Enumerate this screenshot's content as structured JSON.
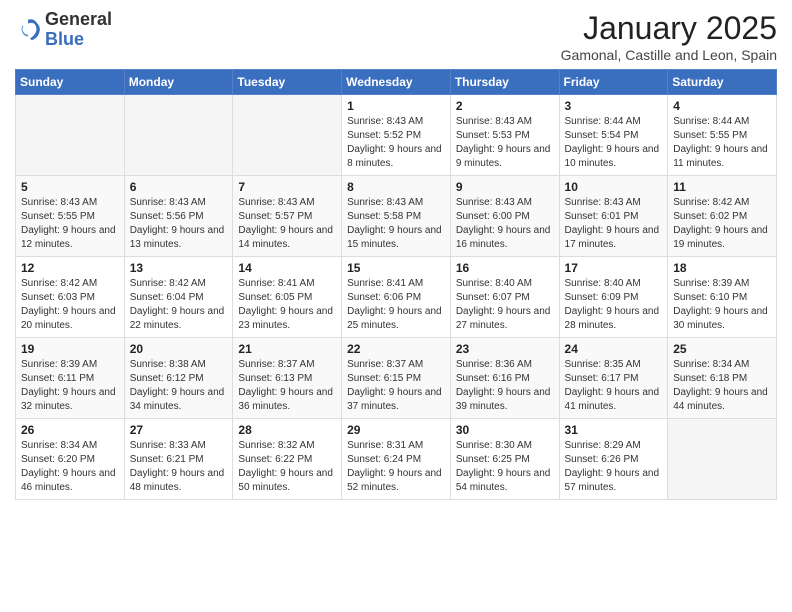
{
  "header": {
    "logo_general": "General",
    "logo_blue": "Blue",
    "month_title": "January 2025",
    "location": "Gamonal, Castille and Leon, Spain"
  },
  "weekdays": [
    "Sunday",
    "Monday",
    "Tuesday",
    "Wednesday",
    "Thursday",
    "Friday",
    "Saturday"
  ],
  "weeks": [
    [
      {
        "day": "",
        "info": ""
      },
      {
        "day": "",
        "info": ""
      },
      {
        "day": "",
        "info": ""
      },
      {
        "day": "1",
        "info": "Sunrise: 8:43 AM\nSunset: 5:52 PM\nDaylight: 9 hours and 8 minutes."
      },
      {
        "day": "2",
        "info": "Sunrise: 8:43 AM\nSunset: 5:53 PM\nDaylight: 9 hours and 9 minutes."
      },
      {
        "day": "3",
        "info": "Sunrise: 8:44 AM\nSunset: 5:54 PM\nDaylight: 9 hours and 10 minutes."
      },
      {
        "day": "4",
        "info": "Sunrise: 8:44 AM\nSunset: 5:55 PM\nDaylight: 9 hours and 11 minutes."
      }
    ],
    [
      {
        "day": "5",
        "info": "Sunrise: 8:43 AM\nSunset: 5:55 PM\nDaylight: 9 hours and 12 minutes."
      },
      {
        "day": "6",
        "info": "Sunrise: 8:43 AM\nSunset: 5:56 PM\nDaylight: 9 hours and 13 minutes."
      },
      {
        "day": "7",
        "info": "Sunrise: 8:43 AM\nSunset: 5:57 PM\nDaylight: 9 hours and 14 minutes."
      },
      {
        "day": "8",
        "info": "Sunrise: 8:43 AM\nSunset: 5:58 PM\nDaylight: 9 hours and 15 minutes."
      },
      {
        "day": "9",
        "info": "Sunrise: 8:43 AM\nSunset: 6:00 PM\nDaylight: 9 hours and 16 minutes."
      },
      {
        "day": "10",
        "info": "Sunrise: 8:43 AM\nSunset: 6:01 PM\nDaylight: 9 hours and 17 minutes."
      },
      {
        "day": "11",
        "info": "Sunrise: 8:42 AM\nSunset: 6:02 PM\nDaylight: 9 hours and 19 minutes."
      }
    ],
    [
      {
        "day": "12",
        "info": "Sunrise: 8:42 AM\nSunset: 6:03 PM\nDaylight: 9 hours and 20 minutes."
      },
      {
        "day": "13",
        "info": "Sunrise: 8:42 AM\nSunset: 6:04 PM\nDaylight: 9 hours and 22 minutes."
      },
      {
        "day": "14",
        "info": "Sunrise: 8:41 AM\nSunset: 6:05 PM\nDaylight: 9 hours and 23 minutes."
      },
      {
        "day": "15",
        "info": "Sunrise: 8:41 AM\nSunset: 6:06 PM\nDaylight: 9 hours and 25 minutes."
      },
      {
        "day": "16",
        "info": "Sunrise: 8:40 AM\nSunset: 6:07 PM\nDaylight: 9 hours and 27 minutes."
      },
      {
        "day": "17",
        "info": "Sunrise: 8:40 AM\nSunset: 6:09 PM\nDaylight: 9 hours and 28 minutes."
      },
      {
        "day": "18",
        "info": "Sunrise: 8:39 AM\nSunset: 6:10 PM\nDaylight: 9 hours and 30 minutes."
      }
    ],
    [
      {
        "day": "19",
        "info": "Sunrise: 8:39 AM\nSunset: 6:11 PM\nDaylight: 9 hours and 32 minutes."
      },
      {
        "day": "20",
        "info": "Sunrise: 8:38 AM\nSunset: 6:12 PM\nDaylight: 9 hours and 34 minutes."
      },
      {
        "day": "21",
        "info": "Sunrise: 8:37 AM\nSunset: 6:13 PM\nDaylight: 9 hours and 36 minutes."
      },
      {
        "day": "22",
        "info": "Sunrise: 8:37 AM\nSunset: 6:15 PM\nDaylight: 9 hours and 37 minutes."
      },
      {
        "day": "23",
        "info": "Sunrise: 8:36 AM\nSunset: 6:16 PM\nDaylight: 9 hours and 39 minutes."
      },
      {
        "day": "24",
        "info": "Sunrise: 8:35 AM\nSunset: 6:17 PM\nDaylight: 9 hours and 41 minutes."
      },
      {
        "day": "25",
        "info": "Sunrise: 8:34 AM\nSunset: 6:18 PM\nDaylight: 9 hours and 44 minutes."
      }
    ],
    [
      {
        "day": "26",
        "info": "Sunrise: 8:34 AM\nSunset: 6:20 PM\nDaylight: 9 hours and 46 minutes."
      },
      {
        "day": "27",
        "info": "Sunrise: 8:33 AM\nSunset: 6:21 PM\nDaylight: 9 hours and 48 minutes."
      },
      {
        "day": "28",
        "info": "Sunrise: 8:32 AM\nSunset: 6:22 PM\nDaylight: 9 hours and 50 minutes."
      },
      {
        "day": "29",
        "info": "Sunrise: 8:31 AM\nSunset: 6:24 PM\nDaylight: 9 hours and 52 minutes."
      },
      {
        "day": "30",
        "info": "Sunrise: 8:30 AM\nSunset: 6:25 PM\nDaylight: 9 hours and 54 minutes."
      },
      {
        "day": "31",
        "info": "Sunrise: 8:29 AM\nSunset: 6:26 PM\nDaylight: 9 hours and 57 minutes."
      },
      {
        "day": "",
        "info": ""
      }
    ]
  ]
}
